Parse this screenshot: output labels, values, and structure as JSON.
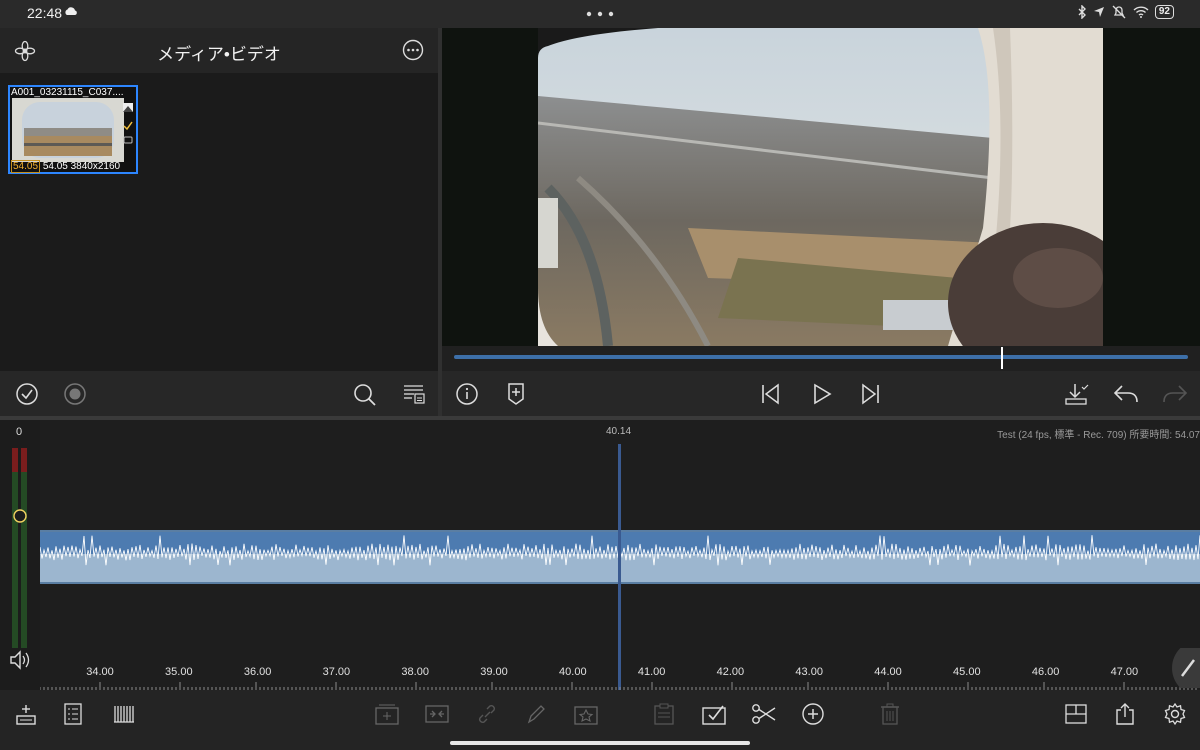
{
  "status_bar": {
    "time": "22:48",
    "battery": "92"
  },
  "media": {
    "title": "メディア•ビデオ",
    "clip": {
      "name": "A001_03231115_C037....",
      "duration_badge": "54.05",
      "details": "54.05 3840x2160"
    }
  },
  "timeline": {
    "project_info": "Test (24 fps, 標準 - Rec. 709) 所要時間: 54.07",
    "position": "40.14",
    "meter_zero": "0",
    "ruler_labels": [
      "34.00",
      "35.00",
      "36.00",
      "37.00",
      "38.00",
      "39.00",
      "40.00",
      "41.00",
      "42.00",
      "43.00",
      "44.00",
      "45.00",
      "46.00",
      "47.00"
    ]
  },
  "colors": {
    "accent": "#2d86ff",
    "track_fill": "#9cb6cf",
    "scrub": "#3d6fa8"
  }
}
